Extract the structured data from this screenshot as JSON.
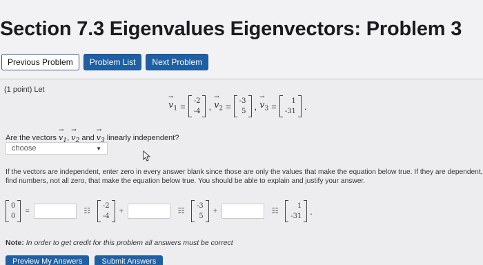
{
  "page": {
    "title": "Section 7.3 Eigenvalues Eigenvectors: Problem 3"
  },
  "nav": {
    "previous": "Previous Problem",
    "list": "Problem List",
    "next": "Next Problem"
  },
  "problem": {
    "points": "(1 point) Let",
    "vectors": [
      {
        "name": "v",
        "sub": "1",
        "values": [
          "-2",
          "-4"
        ]
      },
      {
        "name": "v",
        "sub": "2",
        "values": [
          "-3",
          "5"
        ]
      },
      {
        "name": "v",
        "sub": "3",
        "values": [
          "1",
          "-31"
        ]
      }
    ],
    "question_prefix": "Are the vectors",
    "question_middle": "and",
    "question_suffix": "linearly independent?",
    "select_value": "choose",
    "instructions": "If the vectors are independent, enter zero in every answer blank since those are only the values that make the equation below true. If they are dependent, find numbers, not all zero, that make the equation below true. You should be able to explain and justify your answer.",
    "zero_vector": [
      "0",
      "0"
    ],
    "grid_glyph": "☷",
    "plus": "+",
    "equals": "=",
    "note_label": "Note:",
    "note_text": "In order to get credit for this problem all answers must be correct"
  },
  "footer": {
    "preview": "Preview My Answers",
    "submit": "Submit Answers"
  },
  "colors": {
    "accent": "#1f5fa3",
    "background": "#f2f2f4"
  }
}
